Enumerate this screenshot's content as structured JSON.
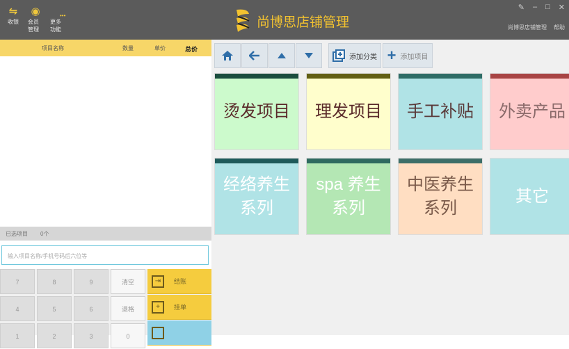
{
  "titlebar": {
    "app_title": "尚博思店铺管理",
    "left_buttons": [
      {
        "label": "收银",
        "icon": "cash-icon"
      },
      {
        "label": "会员管理",
        "icon": "member-icon"
      },
      {
        "label": "更多功能",
        "icon": "more-icon"
      }
    ],
    "dots": "•••",
    "right_links": [
      "尚博思店铺管理",
      "帮助"
    ]
  },
  "order_table": {
    "columns": [
      "项目名称",
      "数量",
      "单价",
      "总价"
    ],
    "rows": []
  },
  "summary": {
    "count_label": "已选项目",
    "count_value": "0个"
  },
  "search": {
    "placeholder": "输入项目名称/手机号码后六位等"
  },
  "keypad": {
    "keys": [
      "7",
      "8",
      "9",
      "清空",
      "4",
      "5",
      "6",
      "退格",
      "1",
      "2",
      "3",
      "0"
    ],
    "actions": [
      {
        "label": "结账",
        "icon": "checkout-icon"
      },
      {
        "label": "挂单",
        "icon": "hold-icon"
      },
      {
        "label": "",
        "icon": "other-icon"
      }
    ]
  },
  "toolbar": {
    "home_icon": "home-icon",
    "back_icon": "back-arrow-icon",
    "up_icon": "up-icon",
    "down_icon": "down-icon",
    "add_category_label": "添加分类",
    "add_item_label": "添加项目"
  },
  "categories": [
    {
      "label": "烫发项目",
      "bg": "#ccfacc",
      "stripe": "#1b4d3e",
      "color": "#5a2a2a"
    },
    {
      "label": "理发项目",
      "bg": "#fffecc",
      "stripe": "#625f14",
      "color": "#5a2a2a"
    },
    {
      "label": "手工补贴",
      "bg": "#b0e3e6",
      "stripe": "#2f6c66",
      "color": "#5a3a3a"
    },
    {
      "label": "外卖产品",
      "bg": "#ffcccc",
      "stripe": "#a84444",
      "color": "#8a6a6a"
    },
    {
      "label": "经络养生系列",
      "bg": "#b0e3e6",
      "stripe": "#1f5a5a",
      "color": "#ffffff"
    },
    {
      "label": "spa 养生系列",
      "bg": "#b4e7b4",
      "stripe": "#2f6a60",
      "color": "#ffffff"
    },
    {
      "label": "中医养生系列",
      "bg": "#ffdec2",
      "stripe": "#3d6e68",
      "color": "#7a5a4a"
    },
    {
      "label": "其它",
      "bg": "#b0e3e6",
      "stripe": "#b0e3e6",
      "color": "#ffffff"
    }
  ]
}
